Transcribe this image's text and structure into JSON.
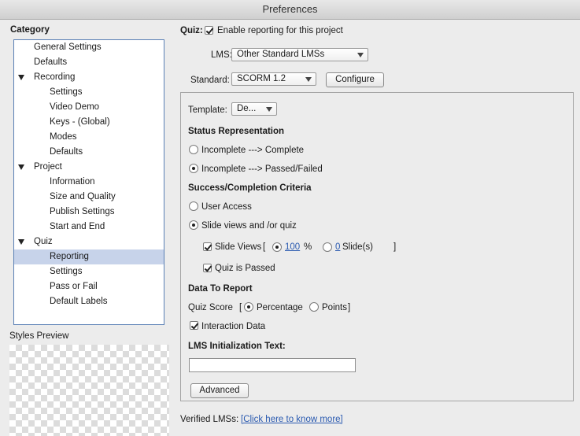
{
  "window": {
    "title": "Preferences"
  },
  "category": {
    "heading": "Category",
    "items": [
      {
        "label": "General Settings",
        "level": 0,
        "expander": false,
        "selected": false
      },
      {
        "label": "Defaults",
        "level": 0,
        "expander": false,
        "selected": false
      },
      {
        "label": "Recording",
        "level": 0,
        "expander": true,
        "selected": false
      },
      {
        "label": "Settings",
        "level": 1,
        "expander": false,
        "selected": false
      },
      {
        "label": "Video Demo",
        "level": 1,
        "expander": false,
        "selected": false
      },
      {
        "label": "Keys - (Global)",
        "level": 1,
        "expander": false,
        "selected": false
      },
      {
        "label": "Modes",
        "level": 1,
        "expander": false,
        "selected": false
      },
      {
        "label": "Defaults",
        "level": 1,
        "expander": false,
        "selected": false
      },
      {
        "label": "Project",
        "level": 0,
        "expander": true,
        "selected": false
      },
      {
        "label": "Information",
        "level": 1,
        "expander": false,
        "selected": false
      },
      {
        "label": "Size and Quality",
        "level": 1,
        "expander": false,
        "selected": false
      },
      {
        "label": "Publish Settings",
        "level": 1,
        "expander": false,
        "selected": false
      },
      {
        "label": "Start and End",
        "level": 1,
        "expander": false,
        "selected": false
      },
      {
        "label": "Quiz",
        "level": 0,
        "expander": true,
        "selected": false
      },
      {
        "label": "Reporting",
        "level": 1,
        "expander": false,
        "selected": true
      },
      {
        "label": "Settings",
        "level": 1,
        "expander": false,
        "selected": false
      },
      {
        "label": "Pass or Fail",
        "level": 1,
        "expander": false,
        "selected": false
      },
      {
        "label": "Default Labels",
        "level": 1,
        "expander": false,
        "selected": false
      }
    ]
  },
  "styles_preview": {
    "label": "Styles Preview"
  },
  "quiz": {
    "label": "Quiz:",
    "enable_reporting": {
      "label": "Enable reporting for this project",
      "checked": true
    },
    "lms": {
      "label": "LMS:",
      "value": "Other Standard LMSs"
    },
    "standard": {
      "label": "Standard:",
      "value": "SCORM 1.2",
      "configure_label": "Configure"
    }
  },
  "panel": {
    "template": {
      "label": "Template:",
      "value": "De..."
    },
    "status": {
      "heading": "Status Representation",
      "option1": {
        "label": "Incomplete ---> Complete",
        "selected": false
      },
      "option2": {
        "label": "Incomplete ---> Passed/Failed",
        "selected": true
      }
    },
    "criteria": {
      "heading": "Success/Completion Criteria",
      "user_access": {
        "label": "User Access",
        "selected": false
      },
      "slide_views_quiz": {
        "label": "Slide views and /or quiz",
        "selected": true
      },
      "slide_views": {
        "label": "Slide Views",
        "open_bracket": "[",
        "close_bracket": "]",
        "checked": true,
        "percent_value": "100",
        "percent_unit": "%",
        "percent_selected": true,
        "slides_value": "0",
        "slides_unit": "Slide(s)",
        "slides_selected": false
      },
      "quiz_passed": {
        "label": "Quiz is Passed",
        "checked": true
      }
    },
    "data_report": {
      "heading": "Data To Report",
      "quiz_score_label": "Quiz Score",
      "open_bracket": "[",
      "close_bracket": "]",
      "percentage": {
        "label": "Percentage",
        "selected": true
      },
      "points": {
        "label": "Points",
        "selected": false
      },
      "interaction_data": {
        "label": "Interaction Data",
        "checked": true
      }
    },
    "lms_init": {
      "heading": "LMS Initialization Text:",
      "value": ""
    },
    "advanced_label": "Advanced"
  },
  "footer": {
    "verified_label": "Verified LMSs:",
    "link_text": "[Click here to know more]"
  }
}
